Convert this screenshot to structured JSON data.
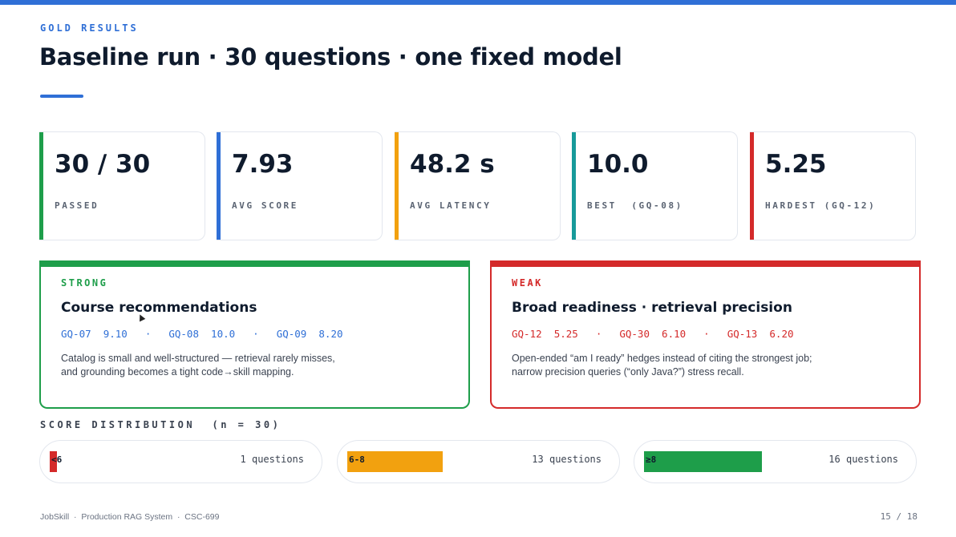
{
  "header": {
    "eyebrow": "GOLD RESULTS",
    "title": "Baseline run · 30 questions · one fixed model"
  },
  "stats": [
    {
      "value": "30 / 30",
      "label": "PASSED",
      "color": "#1e9e4a"
    },
    {
      "value": "7.93",
      "label": "AVG SCORE",
      "color": "#2f6fd6"
    },
    {
      "value": "48.2 s",
      "label": "AVG LATENCY",
      "color": "#f2a10f"
    },
    {
      "value": "10.0",
      "label": "BEST  (GQ-08)",
      "color": "#179a9a"
    },
    {
      "value": "5.25",
      "label": "HARDEST (GQ-12)",
      "color": "#d42a2a"
    }
  ],
  "strong": {
    "tag": "STRONG",
    "heading": "Course recommendations",
    "items": [
      {
        "id": "GQ-07",
        "score": "9.10"
      },
      {
        "id": "GQ-08",
        "score": "10.0"
      },
      {
        "id": "GQ-09",
        "score": "8.20"
      }
    ],
    "separator": "·",
    "desc_line1": "Catalog is small and well-structured — retrieval rarely misses,",
    "desc_line2": "and grounding becomes a tight code→skill mapping.",
    "color": "#1e9e4a",
    "id_color": "#2f6fd6"
  },
  "weak": {
    "tag": "WEAK",
    "heading": "Broad readiness · retrieval precision",
    "items": [
      {
        "id": "GQ-12",
        "score": "5.25"
      },
      {
        "id": "GQ-30",
        "score": "6.10"
      },
      {
        "id": "GQ-13",
        "score": "6.20"
      }
    ],
    "separator": "·",
    "desc_line1": "Open-ended “am I ready” hedges instead of citing the strongest job;",
    "desc_line2": "narrow precision queries (“only Java?”) stress recall.",
    "color": "#d42a2a",
    "id_color": "#d42a2a"
  },
  "distribution": {
    "title": "SCORE DISTRIBUTION  (n = 30)",
    "total": 30,
    "bins": [
      {
        "label": "<6",
        "count": 1,
        "count_text": "1 questions",
        "color": "#d42a2a"
      },
      {
        "label": "6-8",
        "count": 13,
        "count_text": "13 questions",
        "color": "#f2a10f"
      },
      {
        "label": "≥8",
        "count": 16,
        "count_text": "16 questions",
        "color": "#1e9e4a"
      }
    ]
  },
  "footer": {
    "left": "JobSkill  ·  Production RAG System  ·  CSC-699",
    "page": "15 / 18"
  }
}
